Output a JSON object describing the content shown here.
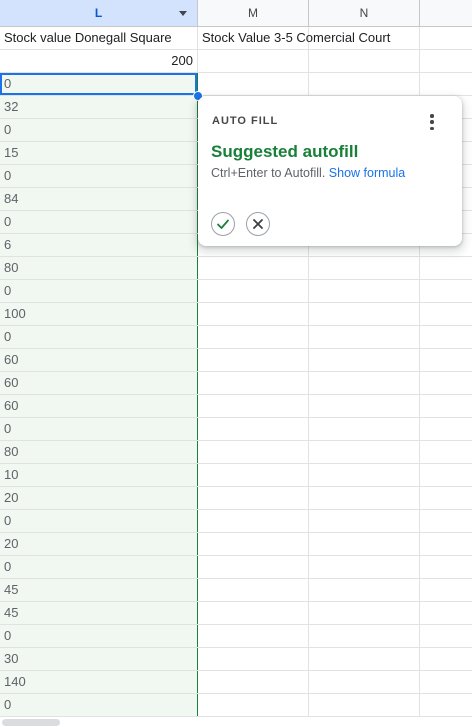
{
  "columns": {
    "L": "L",
    "M": "M",
    "N": "N"
  },
  "header_row": {
    "L": "Stock value Donegall Square",
    "M": "Stock Value 3-5 Comercial Court"
  },
  "total_row": {
    "L": "200"
  },
  "suggested_values": [
    "0",
    "32",
    "0",
    "15",
    "0",
    "84",
    "0",
    "6",
    "80",
    "0",
    "100",
    "0",
    "60",
    "60",
    "60",
    "0",
    "80",
    "10",
    "20",
    "0",
    "20",
    "0",
    "45",
    "45",
    "0",
    "30",
    "140",
    "0"
  ],
  "autofill_popup": {
    "heading": "AUTO FILL",
    "title": "Suggested autofill",
    "hint": "Ctrl+Enter to Autofill.",
    "link": "Show formula"
  },
  "colors": {
    "accent": "#1a73e8",
    "suggestion_green": "#188038",
    "suggestion_background": "#f1f7f1"
  },
  "icons": {
    "more_menu": "more-vertical-icon",
    "accept": "check-icon",
    "reject": "close-icon",
    "column_menu": "dropdown-arrow-icon"
  }
}
